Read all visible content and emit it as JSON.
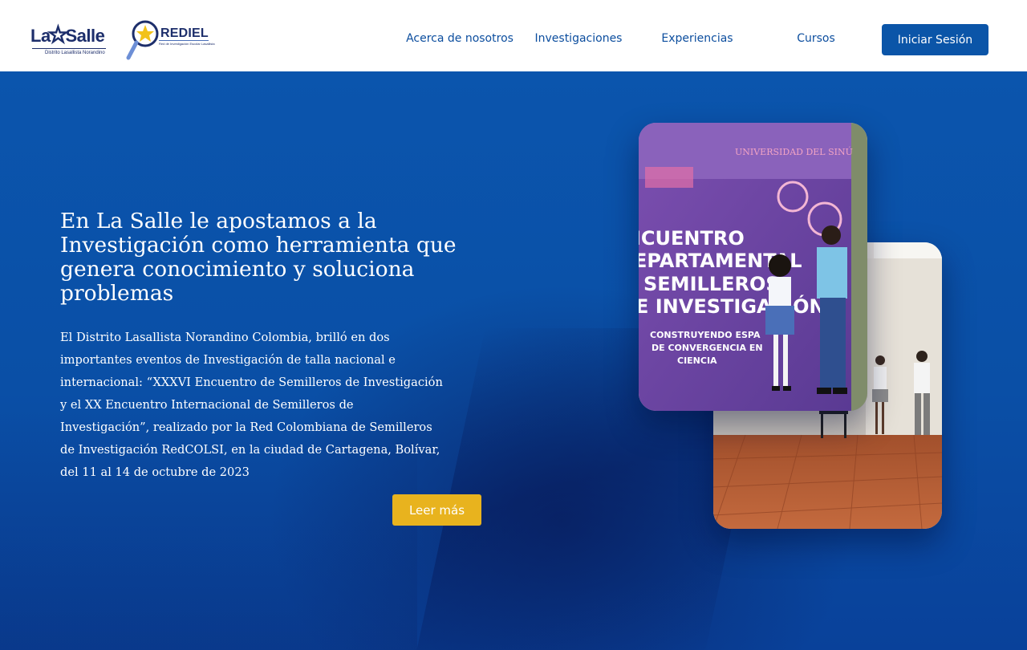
{
  "header": {
    "logo_lasalle": {
      "name": "La Salle",
      "sub": "Distrito Lasallista Norandino"
    },
    "logo_rediel": {
      "name": "REDIEL",
      "sub": "Red de Investigación Escolar Lasallista"
    },
    "nav": [
      {
        "label": "Acerca de nosotros"
      },
      {
        "label": "Investigaciones"
      },
      {
        "label": "Experiencias"
      },
      {
        "label": "Cursos"
      }
    ],
    "login_label": "Iniciar Sesión"
  },
  "hero": {
    "title": "En La Salle le apostamos a la Investigación como herramienta que genera conocimiento y soluciona problemas",
    "body": "El Distrito Lasallista Norandino Colombia, brilló en dos\nimportantes eventos de Investigación de talla nacional e\ninternacional: “XXXVI Encuentro de Semilleros de Investigación\ny el  XX Encuentro Internacional de Semilleros de\nInvestigación”, realizado por la Red Colombiana de Semilleros\nde Investigación  RedCOLSI, en la ciudad de Cartagena, Bolívar,\ndel 11 al 14 de octubre de 2023",
    "read_more_label": "Leer más"
  },
  "photos": {
    "front_banner_lines": [
      "ICUENTRO",
      "EPARTAMENTAL",
      "SEMILLEROS",
      "E INVESTIGACIÓN"
    ],
    "front_banner_sub": [
      "CONSTRUYENDO ESPA",
      "DE CONVERGENCIA EN",
      "CIENCIA"
    ],
    "front_banner_top": "UNIVERSIDAD DEL SINÚ"
  },
  "colors": {
    "brand_blue": "#0b55a8",
    "nav_text": "#0b4d9e",
    "accent_yellow": "#e8b31e",
    "hero_bg": "#0a4fa6"
  }
}
